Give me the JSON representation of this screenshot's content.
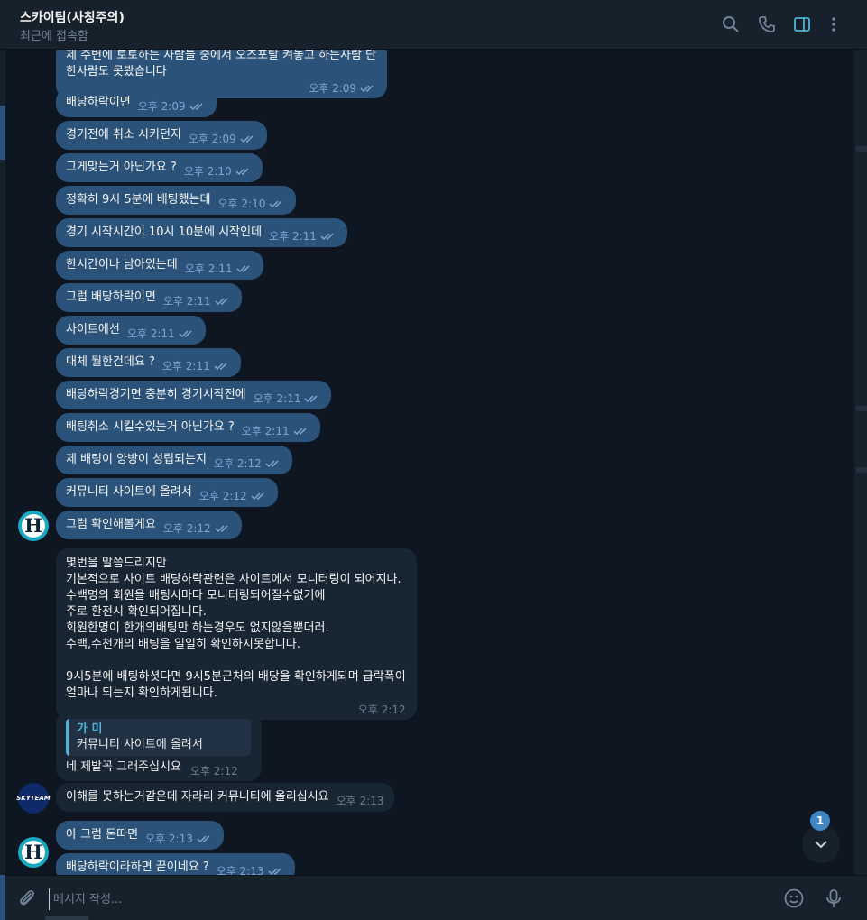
{
  "header": {
    "title": "스카이팀(사칭주의)",
    "status": "최근에 접속함"
  },
  "messages": [
    {
      "text": "제 주변에 토토하는 사람들 중에서 오즈포탈 켜놓고 하는사람 단\n한사람도 못봤습니다",
      "time": "오후 2:09"
    },
    {
      "text": "배당하락이면",
      "time": "오후 2:09"
    },
    {
      "text": "경기전에 취소 시키던지",
      "time": "오후 2:09"
    },
    {
      "text": "그게맞는거 아닌가요 ?",
      "time": "오후 2:10"
    },
    {
      "text": "정확히 9시 5분에 배팅했는데",
      "time": "오후 2:10"
    },
    {
      "text": "경기 시작시간이 10시 10분에 시작인데",
      "time": "오후 2:11"
    },
    {
      "text": "한시간이나 남아있는데",
      "time": "오후 2:11"
    },
    {
      "text": "그럼 배당하락이면",
      "time": "오후 2:11"
    },
    {
      "text": "사이트에선",
      "time": "오후 2:11"
    },
    {
      "text": "대체 뭘한건데요 ?",
      "time": "오후 2:11"
    },
    {
      "text": "배당하락경기면 충분히 경기시작전에",
      "time": "오후 2:11"
    },
    {
      "text": "배팅취소 시킬수있는거 아닌가요 ?",
      "time": "오후 2:11"
    },
    {
      "text": "제 배팅이 양방이 성립되는지",
      "time": "오후 2:12"
    },
    {
      "text": "커뮤니티 사이트에 올려서",
      "time": "오후 2:12"
    },
    {
      "text": "그럼 확인해볼게요",
      "time": "오후 2:12"
    },
    {
      "text": "몇번을 말씀드리지만\n기본적으로 사이트 배당하락관련은 사이트에서 모니터링이 되어지나.\n수백명의 회원을 배팅시마다 모니터링되어질수없기에\n주로 환전시 확인되어집니다.\n회원한명이 한개의배팅만 하는경우도 없지않을뿐더러.\n수백,수천개의 배팅을 일일히 확인하지못합니다.\n\n9시5분에 배팅하셧다면 9시5분근처의 배당을 확인하게되며 급락폭이\n얼마나 되는지 확인하게됩니다.",
      "time": "오후 2:12"
    },
    {
      "reply_name": "가 미",
      "reply_text": "커뮤니티 사이트에 올려서",
      "text": "네 제발꼭 그래주십시요",
      "time": "오후 2:12"
    },
    {
      "text": "이해를 못하는거같은데 자라리 커뮤니티에 올리십시요",
      "time": "오후 2:13"
    },
    {
      "text": "아 그럼 돈따면",
      "time": "오후 2:13"
    },
    {
      "text": "배당하락이라하면 끝이네요 ?",
      "time": "오후 2:13"
    }
  ],
  "avatars": {
    "user": "H",
    "sky": "SKYTEAM"
  },
  "scroll": {
    "unread_count": "1"
  },
  "input": {
    "placeholder": "메시지 작성..."
  },
  "colors": {
    "outgoing": "#2b5278",
    "incoming": "#182533",
    "accent": "#4fb3d9"
  }
}
